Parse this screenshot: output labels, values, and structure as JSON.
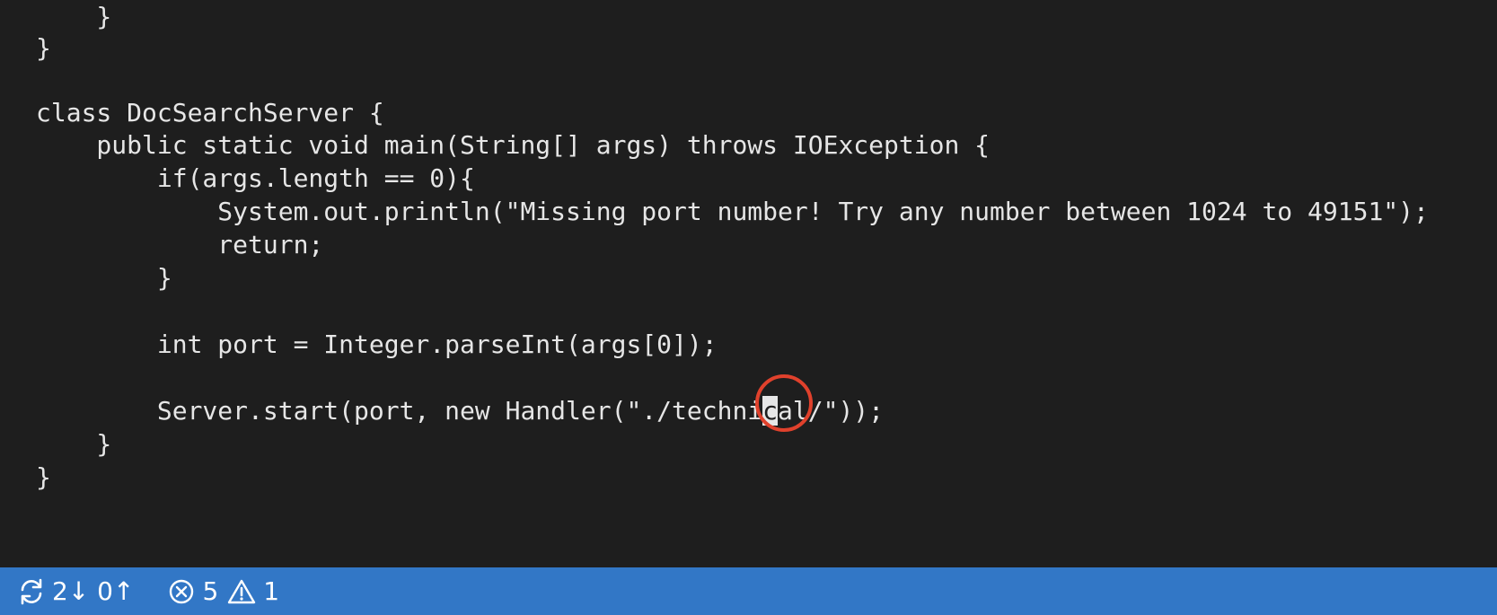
{
  "editor": {
    "lines": [
      "    }",
      "}",
      "",
      "class DocSearchServer {",
      "    public static void main(String[] args) throws IOException {",
      "        if(args.length == 0){",
      "            System.out.println(\"Missing port number! Try any number between 1024 to 49151\");",
      "            return;",
      "        }",
      "",
      "        int port = Integer.parseInt(args[0]);",
      "",
      "        Server.start(port, new Handler(\"./technical/\"));",
      "    }",
      "}"
    ],
    "cursor_line": {
      "before": "        Server.start(port, new Handler(\"./techni",
      "cursor_char": "c",
      "after": "al/\"));"
    }
  },
  "statusbar": {
    "sync_icon": "sync-icon",
    "sync_counts": "2↓ 0↑",
    "errors_icon": "error-circle-icon",
    "errors_count": "5",
    "warnings_icon": "warning-triangle-icon",
    "warnings_count": "1"
  },
  "colors": {
    "editor_bg": "#1e1e1e",
    "text": "#e6e6e6",
    "statusbar_bg": "#3277c6",
    "annotation": "#e0412c"
  }
}
